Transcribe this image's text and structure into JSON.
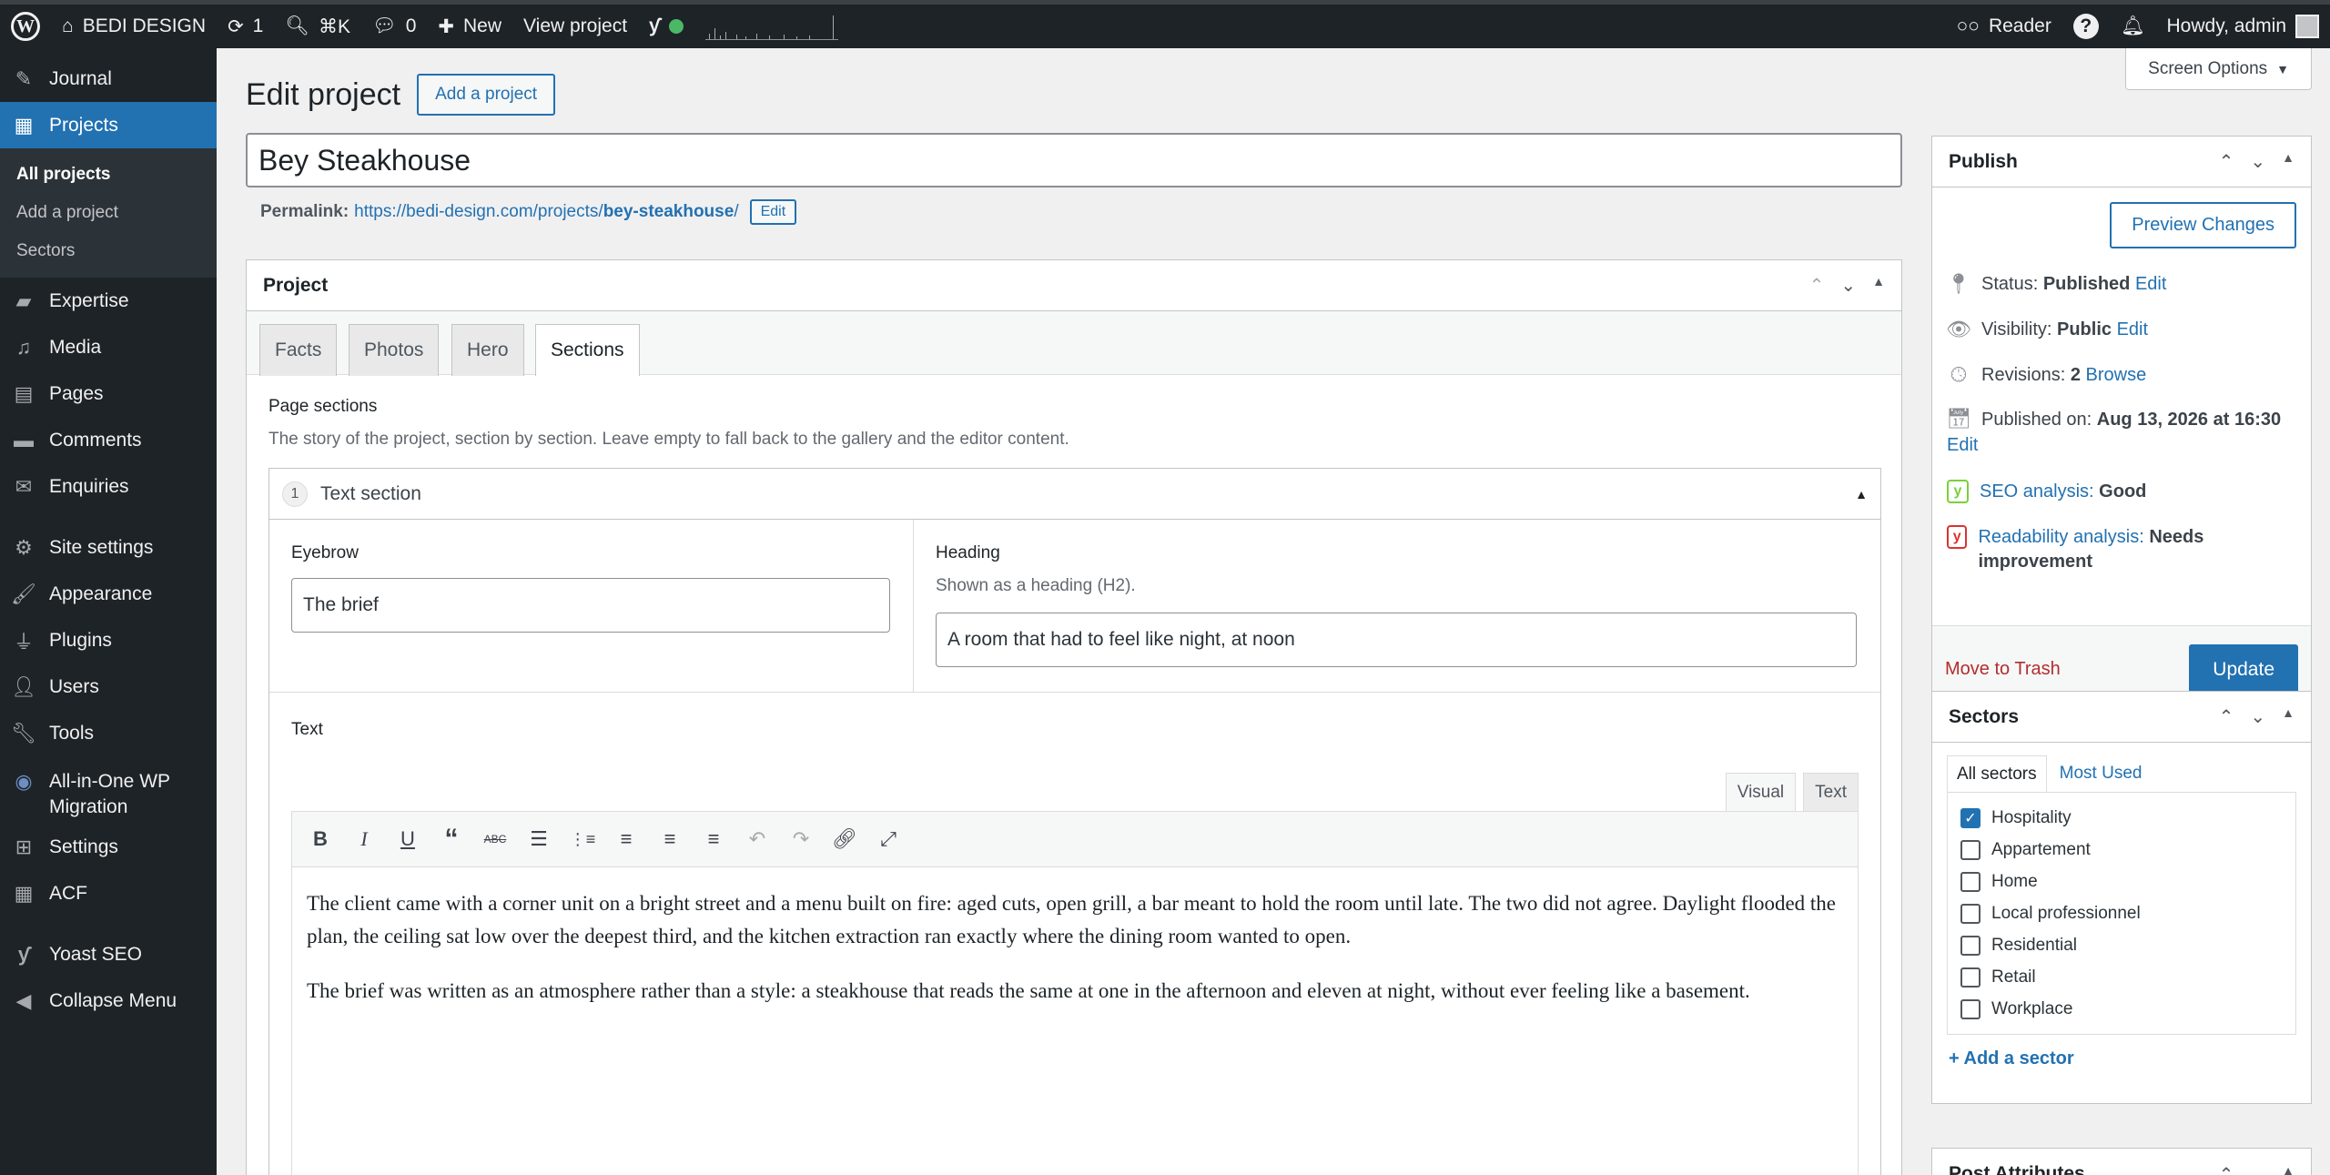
{
  "adminbar": {
    "site_name": "BEDI DESIGN",
    "updates_count": "1",
    "search_shortcut": "⌘K",
    "comments_count": "0",
    "new_label": "New",
    "view_label": "View project",
    "reader_label": "Reader",
    "howdy_label": "Howdy, admin"
  },
  "sidebar": {
    "items": [
      {
        "label": "Journal",
        "icon": "pencil-square-icon"
      },
      {
        "label": "Projects",
        "icon": "grid-icon"
      },
      {
        "label": "Expertise",
        "icon": "folder-icon"
      },
      {
        "label": "Media",
        "icon": "media-icon"
      },
      {
        "label": "Pages",
        "icon": "pages-icon"
      },
      {
        "label": "Comments",
        "icon": "comment-icon"
      },
      {
        "label": "Enquiries",
        "icon": "envelope-icon"
      },
      {
        "label": "Site settings",
        "icon": "gear-icon"
      },
      {
        "label": "Appearance",
        "icon": "brush-icon"
      },
      {
        "label": "Plugins",
        "icon": "plug-icon"
      },
      {
        "label": "Users",
        "icon": "user-icon"
      },
      {
        "label": "Tools",
        "icon": "wrench-icon"
      },
      {
        "label": "All-in-One WP Migration",
        "icon": "migration-icon"
      },
      {
        "label": "Settings",
        "icon": "sliders-icon"
      },
      {
        "label": "ACF",
        "icon": "table-icon"
      },
      {
        "label": "Yoast SEO",
        "icon": "yoast-icon"
      },
      {
        "label": "Collapse Menu",
        "icon": "collapse-icon"
      }
    ],
    "submenu": [
      "All projects",
      "Add a project",
      "Sectors"
    ]
  },
  "page": {
    "title": "Edit project",
    "add_button": "Add a project",
    "screen_options": "Screen Options",
    "post_title": "Bey Steakhouse",
    "permalink_label": "Permalink:",
    "permalink_base": "https://bedi-design.com/projects/",
    "permalink_slug": "bey-steakhouse",
    "permalink_end": "/",
    "permalink_edit": "Edit"
  },
  "project_box": {
    "title": "Project",
    "tabs": [
      "Facts",
      "Photos",
      "Hero",
      "Sections"
    ],
    "sections_label": "Page sections",
    "sections_desc": "The story of the project, section by section. Leave empty to fall back to the gallery and the editor content.",
    "layout_order": "1",
    "layout_name": "Text section",
    "eyebrow_label": "Eyebrow",
    "eyebrow_value": "The brief",
    "heading_label": "Heading",
    "heading_desc": "Shown as a heading (H2).",
    "heading_value": "A room that had to feel like night, at noon",
    "text_label": "Text",
    "editor_tab_visual": "Visual",
    "editor_tab_text": "Text",
    "paragraphs": [
      "The client came with a corner unit on a bright street and a menu built on fire: aged cuts, open grill, a bar meant to hold the room until late. The two did not agree. Daylight flooded the plan, the ceiling sat low over the deepest third, and the kitchen extraction ran exactly where the dining room wanted to open.",
      "The brief was written as an atmosphere rather than a style: a steakhouse that reads the same at one in the afternoon and eleven at night, without ever feeling like a basement."
    ]
  },
  "publish": {
    "title": "Publish",
    "preview": "Preview Changes",
    "status_label": "Status:",
    "status_value": "Published",
    "visibility_label": "Visibility:",
    "visibility_value": "Public",
    "revisions_label": "Revisions:",
    "revisions_value": "2",
    "revisions_link": "Browse",
    "published_label": "Published on:",
    "published_value": "Aug 13, 2026 at 16:30",
    "edit": "Edit",
    "seo_label": "SEO analysis:",
    "seo_value": "Good",
    "readability_label": "Readability analysis:",
    "readability_value": "Needs improvement",
    "trash": "Move to Trash",
    "update": "Update"
  },
  "sectors": {
    "title": "Sectors",
    "tab_all": "All sectors",
    "tab_used": "Most Used",
    "items": [
      {
        "label": "Hospitality",
        "checked": true
      },
      {
        "label": "Appartement",
        "checked": false
      },
      {
        "label": "Home",
        "checked": false
      },
      {
        "label": "Local professionnel",
        "checked": false
      },
      {
        "label": "Residential",
        "checked": false
      },
      {
        "label": "Retail",
        "checked": false
      },
      {
        "label": "Workplace",
        "checked": false
      }
    ],
    "add_link": "+ Add a sector"
  },
  "post_attributes": {
    "title": "Post Attributes"
  },
  "colors": {
    "accent": "#2271b1",
    "adminbar": "#1d2327",
    "seo_good": "#7ad03a",
    "readability_bad": "#dc3232"
  }
}
